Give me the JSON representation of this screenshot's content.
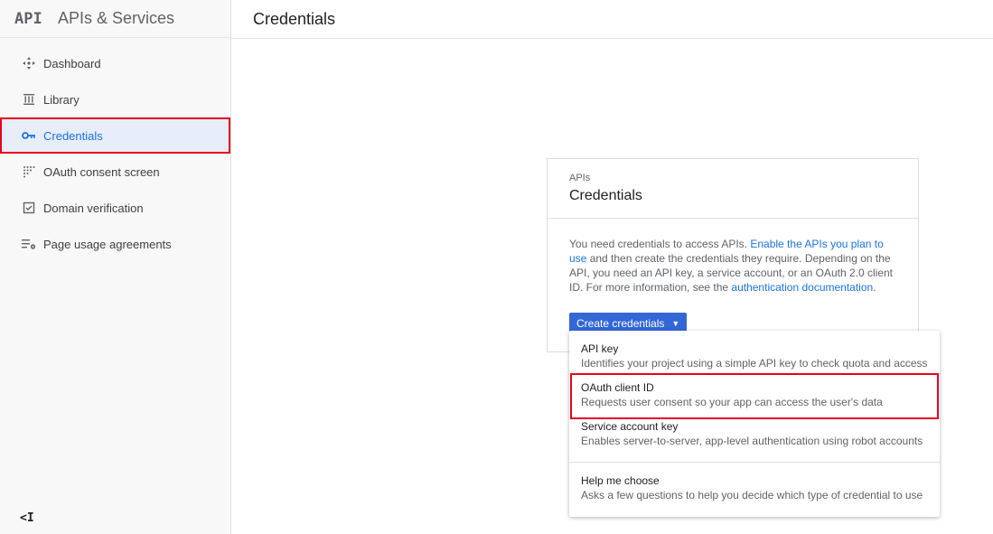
{
  "brand": {
    "logo": "API",
    "name": "APIs & Services"
  },
  "sidebar": {
    "items": [
      {
        "label": "Dashboard",
        "icon": "dashboard-icon"
      },
      {
        "label": "Library",
        "icon": "library-icon"
      },
      {
        "label": "Credentials",
        "icon": "key-icon",
        "active": true
      },
      {
        "label": "OAuth consent screen",
        "icon": "consent-icon"
      },
      {
        "label": "Domain verification",
        "icon": "checkbox-icon"
      },
      {
        "label": "Page usage agreements",
        "icon": "settings-list-icon"
      }
    ],
    "collapse": "<I"
  },
  "header": {
    "title": "Credentials"
  },
  "card": {
    "overline": "APIs",
    "title": "Credentials",
    "text_1": "You need credentials to access APIs. ",
    "link_1": "Enable the APIs you plan to use",
    "text_2": " and then create the credentials they require. Depending on the API, you need an API key, a service account, or an OAuth 2.0 client ID. For more information, see the ",
    "link_2": "authentication documentation",
    "text_3": ".",
    "button": "Create credentials"
  },
  "menu": {
    "items": [
      {
        "title": "API key",
        "desc": "Identifies your project using a simple API key to check quota and access"
      },
      {
        "title": "OAuth client ID",
        "desc": "Requests user consent so your app can access the user's data"
      },
      {
        "title": "Service account key",
        "desc": "Enables server-to-server, app-level authentication using robot accounts"
      },
      {
        "title": "Help me choose",
        "desc": "Asks a few questions to help you decide which type of credential to use"
      }
    ]
  },
  "colors": {
    "accent": "#1a73e8",
    "button": "#3367d6",
    "highlight": "#e8001c"
  }
}
